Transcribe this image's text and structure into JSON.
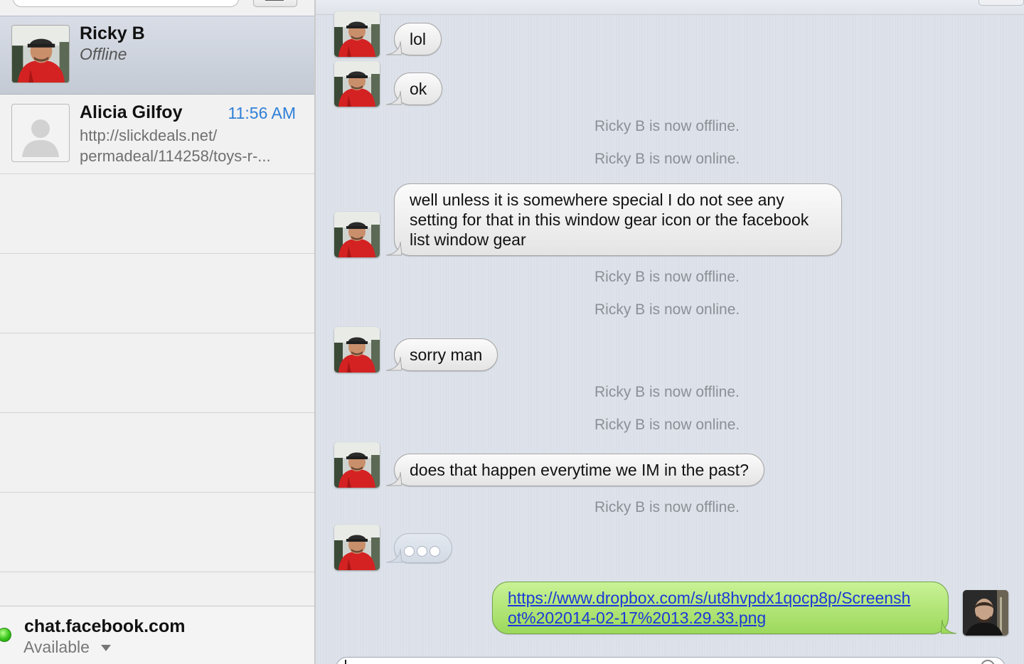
{
  "sidebar": {
    "conversations": [
      {
        "name": "Ricky B",
        "status": "Offline"
      },
      {
        "name": "Alicia Gilfoy",
        "time": "11:56 AM",
        "preview_line1": "http://slickdeals.net/",
        "preview_line2": "permadeal/114258/toys-r-..."
      }
    ],
    "account": {
      "name": "chat.facebook.com",
      "status": "Available"
    }
  },
  "chat": {
    "messages": [
      {
        "text": "lol"
      },
      {
        "text": "ok"
      },
      {
        "system": "Ricky B is now offline."
      },
      {
        "system": "Ricky B is now online."
      },
      {
        "line1": "well unless it is somewhere special I do not see any",
        "line2": "setting for that in this window gear icon or the facebook",
        "line3": "list window gear"
      },
      {
        "system": "Ricky B is now offline."
      },
      {
        "system": "Ricky B is now online."
      },
      {
        "text": "sorry man"
      },
      {
        "system": "Ricky B is now offline."
      },
      {
        "system": "Ricky B is now online."
      },
      {
        "text": "does that happen everytime we IM in the past?"
      },
      {
        "system": "Ricky B is now offline."
      },
      {
        "typing": "typing-indicator"
      },
      {
        "sent_line1": "https://www.dropbox.com/s/ut8hvpdx1qocp8p/Screensh",
        "sent_line2": "ot%202014-02-17%2013.29.33.png"
      }
    ]
  },
  "colors": {
    "accent_time": "#2f7fd8",
    "sent_bubble": "#9cd95c",
    "received_bubble": "#eeeeee",
    "link": "#1b39d8",
    "status_available": "#37c51a"
  },
  "icons": [
    "search-icon",
    "compose-icon",
    "contact-placeholder-icon",
    "status-dot-icon",
    "dropdown-caret-icon",
    "typing-dots-icon"
  ]
}
